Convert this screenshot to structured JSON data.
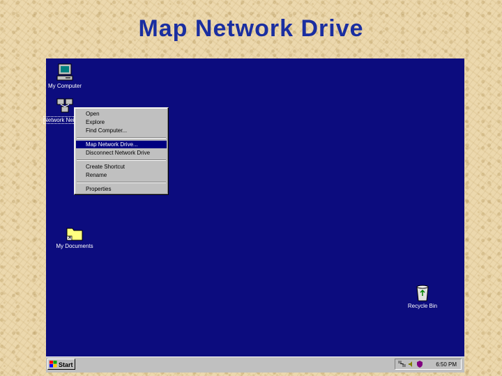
{
  "slide": {
    "title": "Map Network Drive"
  },
  "desktop": {
    "icons": [
      {
        "label": "My Computer",
        "icon": "computer-icon"
      },
      {
        "label": "Network Neighborhood",
        "icon": "network-icon"
      },
      {
        "label": "My Documents",
        "icon": "folder-icon"
      },
      {
        "label": "Recycle Bin",
        "icon": "recycle-bin-icon"
      }
    ],
    "background_color": "#0c0c7e"
  },
  "context_menu": {
    "items": [
      "Open",
      "Explore",
      "Find Computer...",
      "Map Network Drive...",
      "Disconnect Network Drive",
      "Create Shortcut",
      "Rename",
      "Properties"
    ],
    "selected": "Map Network Drive..."
  },
  "taskbar": {
    "start_label": "Start",
    "clock": "6:50 PM",
    "tray_icons": [
      "network-tray-icon",
      "volume-icon",
      "antivirus-icon"
    ]
  }
}
